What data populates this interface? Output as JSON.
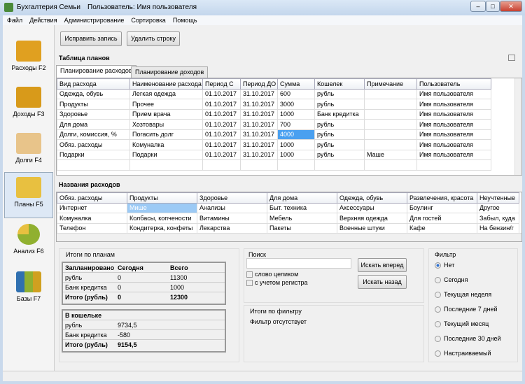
{
  "window": {
    "title": "Бухгалтерия Семьи",
    "user_label": "Пользователь: Имя пользователя"
  },
  "menu": [
    "Файл",
    "Действия",
    "Администрирование",
    "Сортировка",
    "Помощь"
  ],
  "sidebar": [
    {
      "label": "Расходы F2",
      "color": "#e0a020"
    },
    {
      "label": "Доходы F3",
      "color": "#d89a1a"
    },
    {
      "label": "Долги F4",
      "color": "#e8c48a"
    },
    {
      "label": "Планы F5",
      "color": "#e8c040"
    },
    {
      "label": "Анализ F6",
      "color": "#90b030"
    },
    {
      "label": "Базы F7",
      "color": "#3070b0"
    }
  ],
  "toolbar": {
    "edit": "Исправить запись",
    "delete": "Удалить строку"
  },
  "plans": {
    "title": "Таблица планов",
    "tabs": [
      "Планирование расходов",
      "Планирование доходов"
    ],
    "columns": [
      "Вид расхода",
      "Наименование расхода",
      "Период С",
      "Период ДО",
      "Сумма",
      "Кошелек",
      "Примечание",
      "Пользователь"
    ],
    "rows": [
      [
        "Одежда, обувь",
        "Легкая одежда",
        "01.10.2017",
        "31.10.2017",
        "600",
        "рубль",
        "",
        "Имя пользователя"
      ],
      [
        "Продукты",
        "Прочее",
        "01.10.2017",
        "31.10.2017",
        "3000",
        "рубль",
        "",
        "Имя пользователя"
      ],
      [
        "Здоровье",
        "Прием врача",
        "01.10.2017",
        "31.10.2017",
        "1000",
        "Банк кредитка",
        "",
        "Имя пользователя"
      ],
      [
        "Для дома",
        "Хозтовары",
        "01.10.2017",
        "31.10.2017",
        "700",
        "рубль",
        "",
        "Имя пользователя"
      ],
      [
        "Долги, комиссия, %",
        "Погасить долг",
        "01.10.2017",
        "31.10.2017",
        "4000",
        "рубль",
        "",
        "Имя пользователя"
      ],
      [
        "Обяз. расходы",
        "Комуналка",
        "01.10.2017",
        "31.10.2017",
        "1000",
        "рубль",
        "",
        "Имя пользователя"
      ],
      [
        "Подарки",
        "Подарки",
        "01.10.2017",
        "31.10.2017",
        "1000",
        "рубль",
        "Маше",
        "Имя пользователя"
      ]
    ]
  },
  "names": {
    "title": "Названия расходов",
    "columns": [
      "Обяз. расходы",
      "Продукты",
      "Здоровье",
      "Для дома",
      "Одежда, обувь",
      "Развлечения, красота",
      "Неучтенные"
    ],
    "rows": [
      [
        "Интернет",
        "Мише",
        "Анализы",
        "Быт. техника",
        "Аксессуары",
        "Боулинг",
        "Другое"
      ],
      [
        "Комуналка",
        "Колбасы, копчености",
        "Витамины",
        "Мебель",
        "Верхняя одежда",
        "Для гостей",
        "Забыл, куда"
      ],
      [
        "Телефон",
        "Кондитерка, конфеты",
        "Лекарства",
        "Пакеты",
        "Военные штуки",
        "Кафе",
        "На бензин/г"
      ]
    ]
  },
  "totals": {
    "title": "Итоги по планам",
    "planned": {
      "header": [
        "Запланировано",
        "Сегодня",
        "Всего"
      ],
      "rows": [
        [
          "рубль",
          "0",
          "11300"
        ],
        [
          "Банк кредитка",
          "0",
          "1000"
        ]
      ],
      "total": [
        "Итого (рубль)",
        "0",
        "12300"
      ]
    },
    "wallet": {
      "header": "В кошельке",
      "rows": [
        [
          "рубль",
          "9734,5"
        ],
        [
          "Банк кредитка",
          "-580"
        ]
      ],
      "total": [
        "Итого (рубль)",
        "9154,5"
      ]
    }
  },
  "search": {
    "title": "Поиск",
    "value": "",
    "whole_word": "слово целиком",
    "match_case": "с учетом регистра",
    "forward": "Искать вперед",
    "back": "Искать назад"
  },
  "filter_totals": {
    "title": "Итоги по фильтру",
    "text": "Фильтр отсутствует"
  },
  "filter": {
    "title": "Фильтр",
    "options": [
      "Нет",
      "Сегодня",
      "Текущая неделя",
      "Последние 7 дней",
      "Текущий месяц",
      "Последние 30 дней",
      "Настраиваемый"
    ],
    "selected": "Нет"
  }
}
